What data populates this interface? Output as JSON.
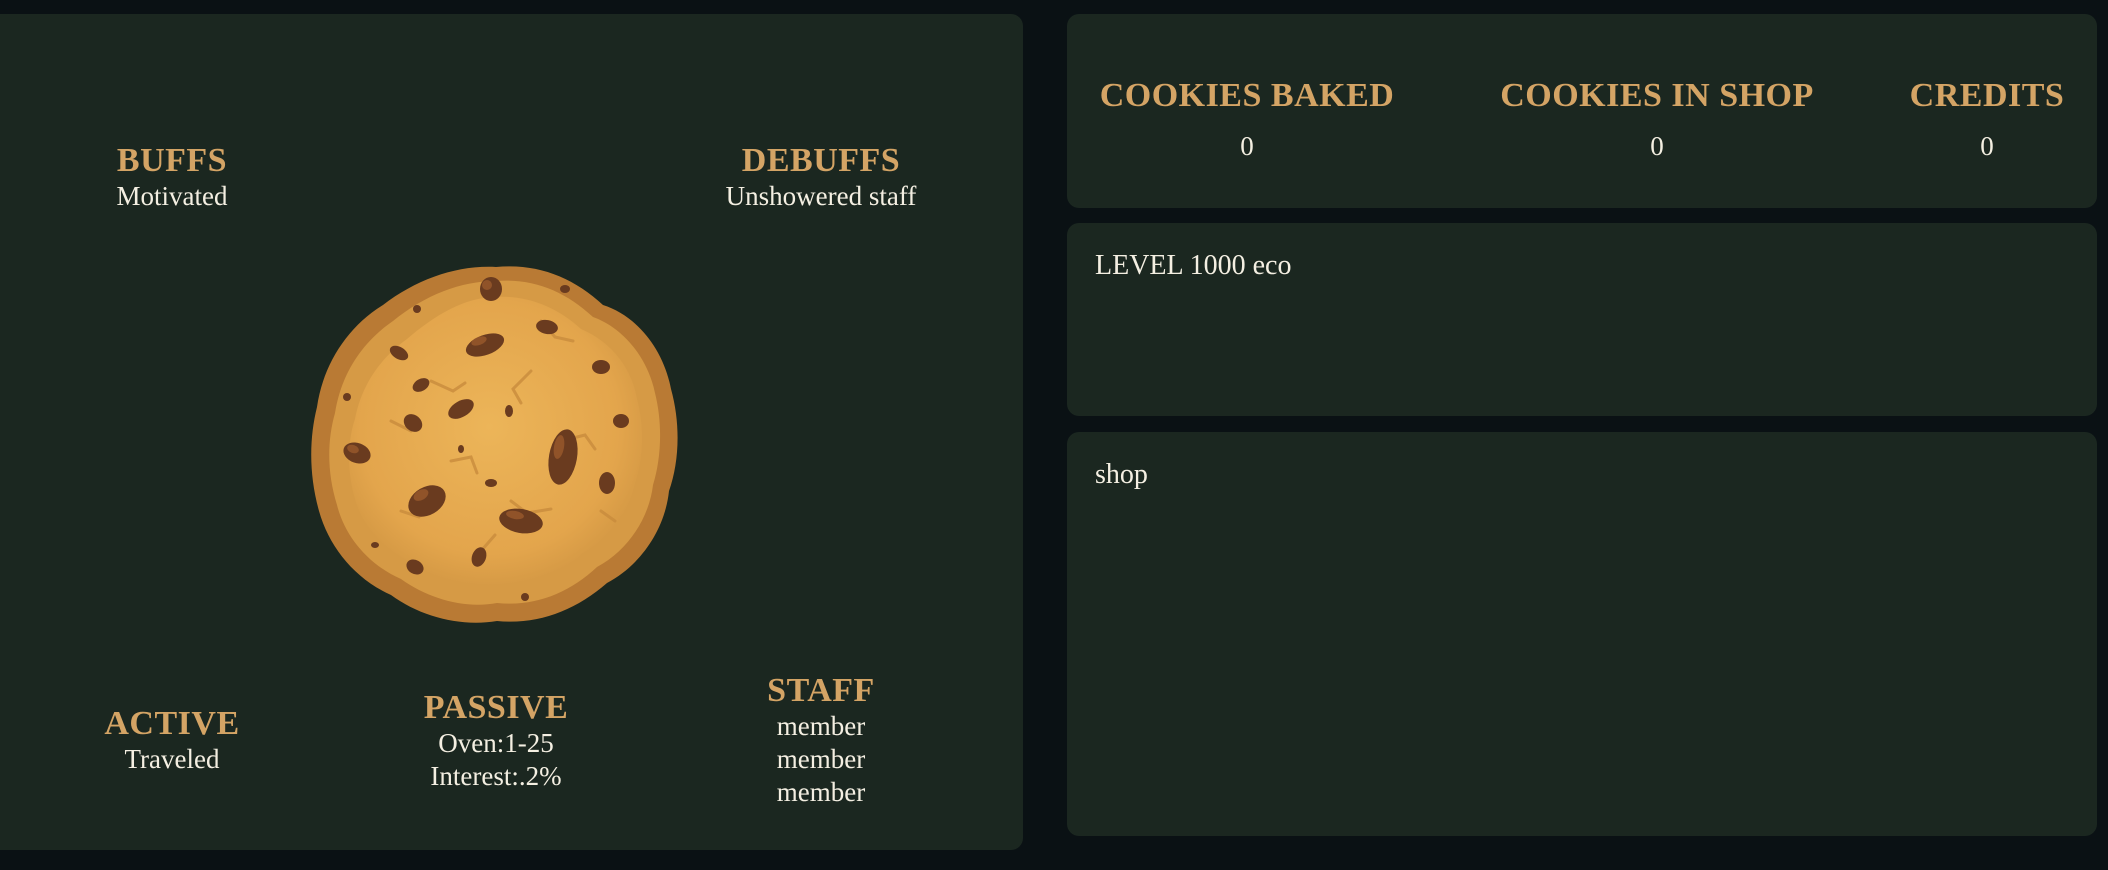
{
  "status": {
    "buffs": {
      "title": "BUFFS",
      "value": "Motivated"
    },
    "debuffs": {
      "title": "DEBUFFS",
      "value": "Unshowered staff"
    },
    "active": {
      "title": "ACTIVE",
      "value": "Traveled"
    },
    "passive": {
      "title": "PASSIVE",
      "lines": [
        "Oven:1-25",
        "Interest:.2%"
      ]
    },
    "staff": {
      "title": "STAFF",
      "members": [
        "member",
        "member",
        "member"
      ]
    }
  },
  "stats": {
    "cookies_baked": {
      "label": "COOKIES BAKED",
      "value": "0"
    },
    "cookies_in_shop": {
      "label": "COOKIES IN SHOP",
      "value": "0"
    },
    "credits": {
      "label": "CREDITS",
      "value": "0"
    }
  },
  "level": {
    "text": "LEVEL 1000 eco"
  },
  "shop": {
    "text": "shop"
  },
  "cookie": {
    "icon": "cookie-icon"
  },
  "colors": {
    "background": "#0a1114",
    "panel": "#1b2720",
    "heading": "#d4a465",
    "text": "#f4efe2"
  }
}
